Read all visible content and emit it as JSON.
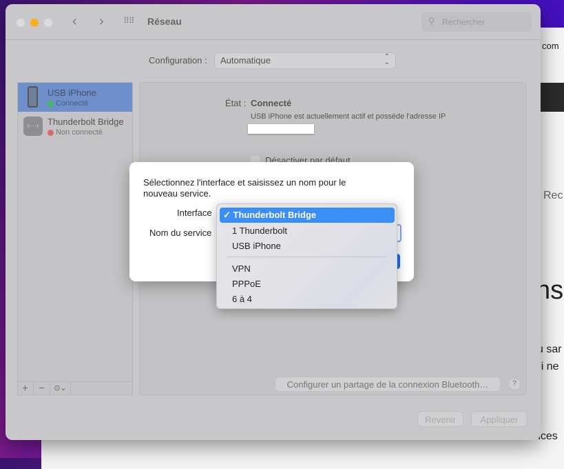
{
  "background": {
    "fragments": [
      "com",
      "Rec",
      "ns",
      "u sar",
      "Fi ne",
      "nces"
    ]
  },
  "window": {
    "title": "Réseau",
    "search_placeholder": "Rechercher"
  },
  "configuration": {
    "label": "Configuration :",
    "value": "Automatique"
  },
  "services": [
    {
      "name": "USB iPhone",
      "status": "Connecté",
      "status_color": "#3fc04a",
      "selected": true
    },
    {
      "name": "Thunderbolt Bridge",
      "status": "Non connecté",
      "status_color": "#e0575a",
      "selected": false
    }
  ],
  "sidebar_footer": {
    "add": "+",
    "remove": "−",
    "action": "⊙⌄"
  },
  "detail": {
    "state_label": "État :",
    "state_value": "Connecté",
    "description": "USB iPhone est actuellement actif et possède l'adresse IP",
    "disable_label": "Désactiver par défaut",
    "bluetooth_button": "Configurer un partage de la connexion Bluetooth…",
    "help": "?",
    "revert": "Revenir",
    "apply": "Appliquer"
  },
  "dialog": {
    "message": "Sélectionnez l'interface et saisissez un nom pour le nouveau service.",
    "interface_label": "Interface",
    "service_name_label": "Nom du service"
  },
  "menu": {
    "selected": "Thunderbolt Bridge",
    "check": "✓",
    "items": [
      "1 Thunderbolt",
      "USB iPhone"
    ],
    "items2": [
      "VPN",
      "PPPoE",
      "6 à 4"
    ]
  },
  "colors": {
    "accent": "#3b8ef5"
  }
}
